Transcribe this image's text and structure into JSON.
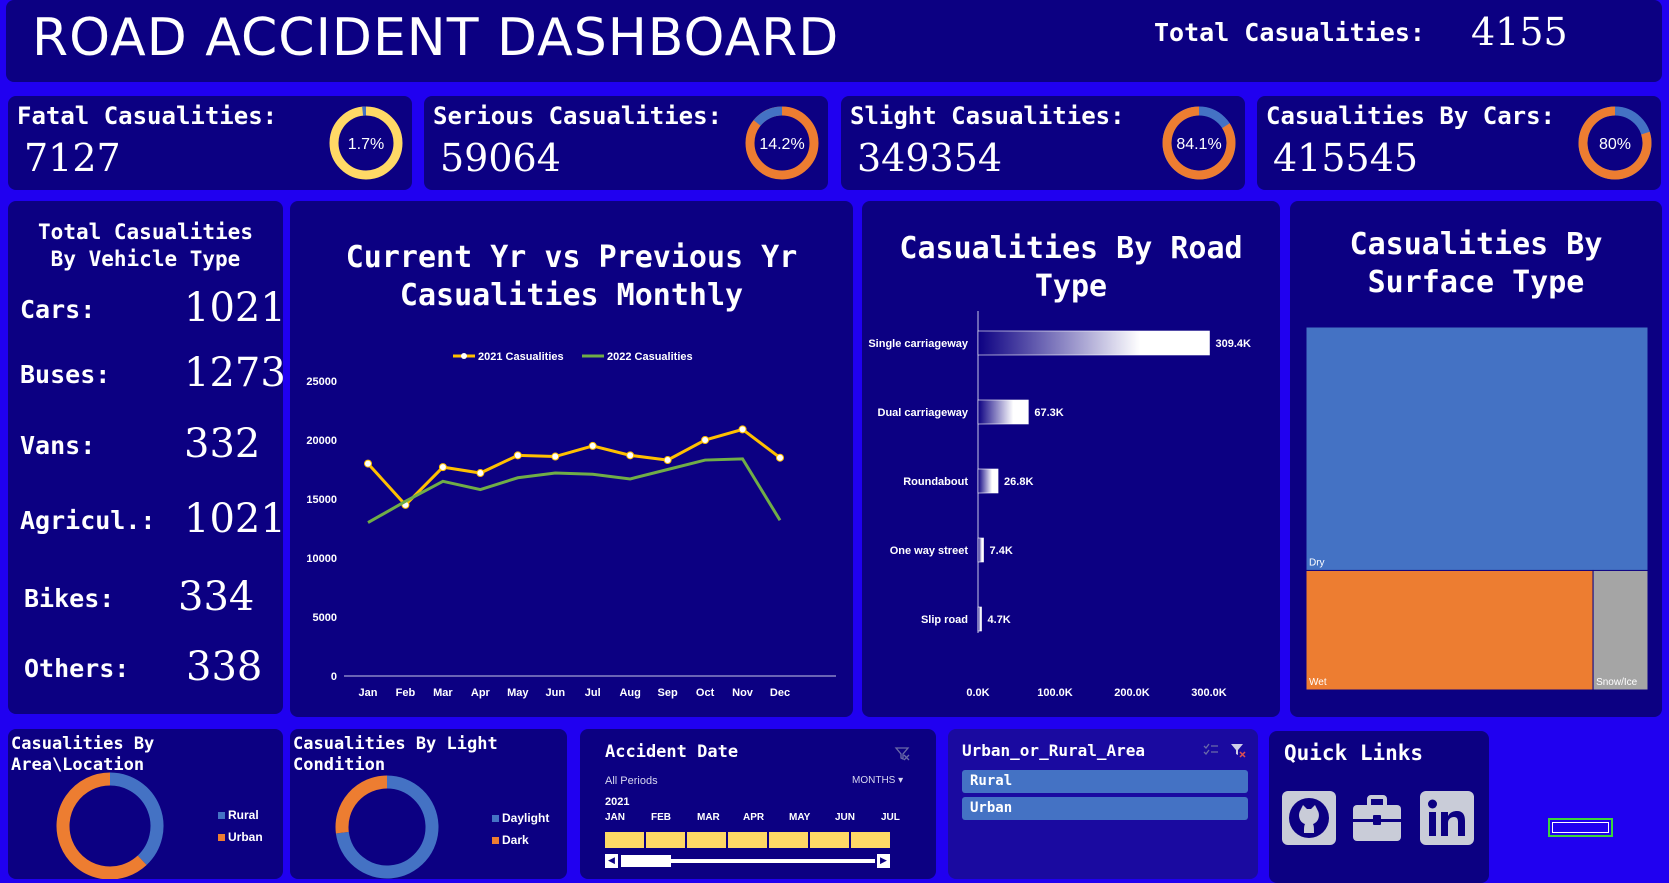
{
  "header": {
    "title": "ROAD ACCIDENT DASHBOARD",
    "total_label": "Total Casualities:",
    "total_value": "4155"
  },
  "kpis": [
    {
      "label": "Fatal Casualities:",
      "value": "7127",
      "pct_text": "1.7%",
      "pct": 1.7,
      "ring_color": "#ffd966",
      "arc_color": "#4472c4"
    },
    {
      "label": "Serious Casualities:",
      "value": "59064",
      "pct_text": "14.2%",
      "pct": 14.2,
      "ring_color": "#ed7d31",
      "arc_color": "#4472c4"
    },
    {
      "label": "Slight Casualities:",
      "value": "349354",
      "pct_text": "84.1%",
      "pct": 84.1,
      "ring_color": "#4472c4",
      "arc_color": "#ed7d31"
    },
    {
      "label": "Casualities By Cars:",
      "value": "415545",
      "pct_text": "80%",
      "pct": 80,
      "ring_color": "#4472c4",
      "arc_color": "#ed7d31"
    }
  ],
  "vehicle": {
    "title_line1": "Total Casualities",
    "title_line2": "By Vehicle Type",
    "rows": [
      {
        "label": "Cars:",
        "value": "1021"
      },
      {
        "label": "Buses:",
        "value": "1273"
      },
      {
        "label": "Vans:",
        "value": "332"
      },
      {
        "label": "Agricul.:",
        "value": "1021"
      },
      {
        "label": "Bikes:",
        "value": "334"
      },
      {
        "label": "Others:",
        "value": "338"
      }
    ]
  },
  "line_chart": {
    "title_line1": "Current Yr vs Previous Yr",
    "title_line2": "Casualities Monthly"
  },
  "road_chart": {
    "title_line1": "Casualities By Road",
    "title_line2": "Type"
  },
  "surface_chart": {
    "title_line1": "Casualities By",
    "title_line2": "Surface Type"
  },
  "area_chart": {
    "title_line1": "Casualities By",
    "title_line2": "Area\\Location"
  },
  "light_chart": {
    "title_line1": "Casualities By Light",
    "title_line2": "Condition"
  },
  "chart_data": [
    {
      "type": "line",
      "title": "Current Yr vs Previous Yr Casualities Monthly",
      "categories": [
        "Jan",
        "Feb",
        "Mar",
        "Apr",
        "May",
        "Jun",
        "Jul",
        "Aug",
        "Sep",
        "Oct",
        "Nov",
        "Dec"
      ],
      "series": [
        {
          "name": "2021 Casualities",
          "color": "#ffc000",
          "values": [
            18000,
            14500,
            17700,
            17200,
            18700,
            18600,
            19500,
            18700,
            18300,
            20000,
            20900,
            18500
          ]
        },
        {
          "name": "2022 Casualities",
          "color": "#70ad47",
          "values": [
            13000,
            14800,
            16500,
            15800,
            16800,
            17200,
            17100,
            16700,
            17500,
            18300,
            18400,
            13200
          ]
        }
      ],
      "yticks": [
        0,
        5000,
        10000,
        15000,
        20000,
        25000
      ],
      "ylim": [
        0,
        25000
      ],
      "legend": "top"
    },
    {
      "type": "bar",
      "title": "Casualities By Road Type",
      "orientation": "horizontal",
      "categories": [
        "Single carriageway",
        "Dual carriageway",
        "Roundabout",
        "One way street",
        "Slip road"
      ],
      "values": [
        309400,
        67300,
        26800,
        7400,
        4700
      ],
      "data_labels": [
        "309.4K",
        "67.3K",
        "26.8K",
        "7.4K",
        "4.7K"
      ],
      "xticks": [
        "0.0K",
        "100.0K",
        "200.0K",
        "300.0K"
      ],
      "xlim": [
        0,
        300000
      ]
    },
    {
      "type": "treemap",
      "title": "Casualities By Surface Type",
      "categories": [
        "Dry",
        "Wet",
        "Snow/Ice"
      ],
      "values": [
        279000,
        115000,
        22000
      ],
      "colors": [
        "#4472c4",
        "#ed7d31",
        "#a5a5a5"
      ]
    },
    {
      "type": "pie",
      "title": "Casualities By Area\\Location",
      "categories": [
        "Rural",
        "Urban"
      ],
      "values": [
        38,
        62
      ],
      "colors": [
        "#4472c4",
        "#ed7d31"
      ],
      "legend": "right"
    },
    {
      "type": "pie",
      "title": "Casualities By Light Condition",
      "categories": [
        "Daylight",
        "Dark"
      ],
      "values": [
        73,
        27
      ],
      "colors": [
        "#4472c4",
        "#ed7d31"
      ],
      "legend": "right"
    }
  ],
  "date_slicer": {
    "title": "Accident Date",
    "all_periods": "All Periods",
    "granularity": "MONTHS",
    "year": "2021",
    "months": [
      "JAN",
      "FEB",
      "MAR",
      "APR",
      "MAY",
      "JUN",
      "JUL"
    ]
  },
  "area_slicer": {
    "title": "Urban_or_Rural_Area",
    "items": [
      "Rural",
      "Urban"
    ]
  },
  "quick_links": {
    "title": "Quick Links",
    "icons": [
      "github-icon",
      "briefcase-icon",
      "linkedin-icon"
    ]
  }
}
